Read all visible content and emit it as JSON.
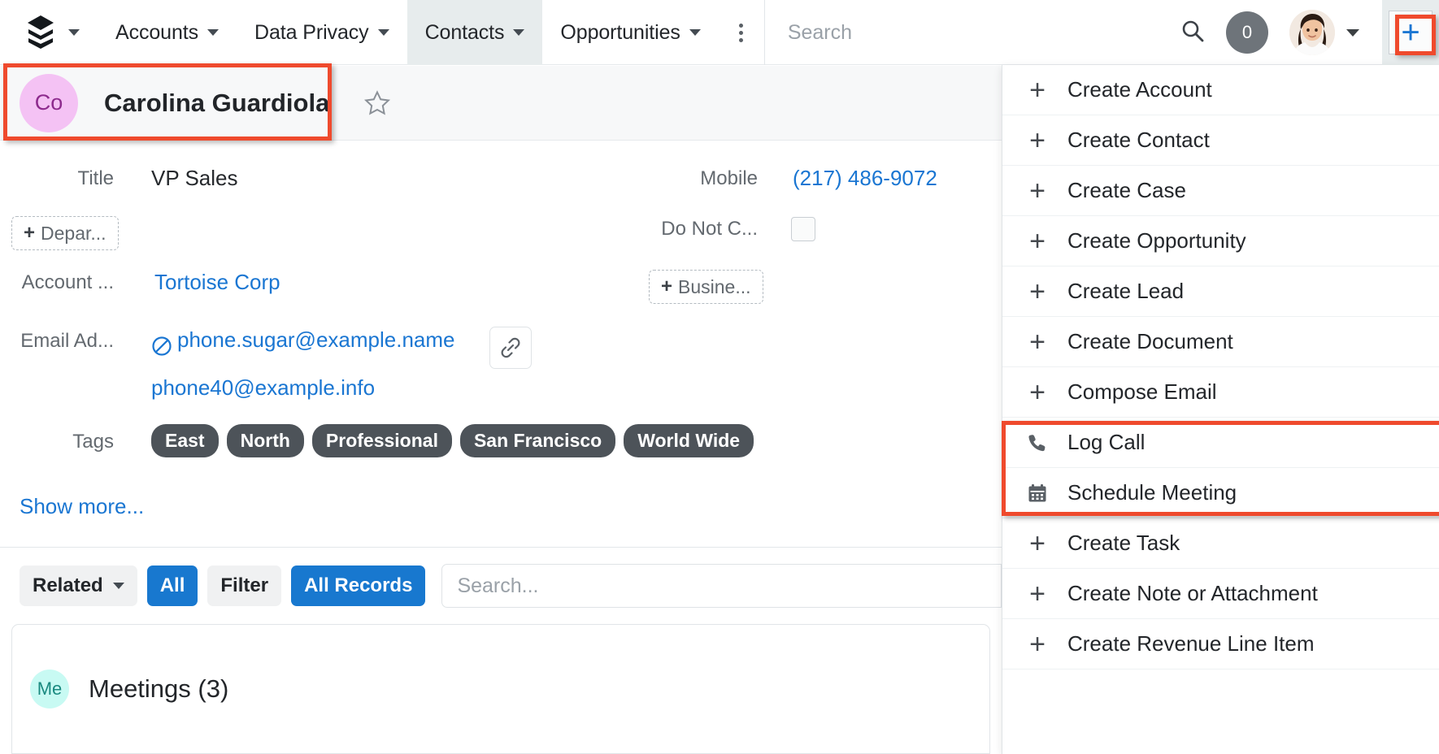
{
  "navbar": {
    "logo_icon": "layers-stack-icon",
    "logo_caret_icon": "chevron-down-icon",
    "modules": [
      {
        "label": "Accounts",
        "active": false
      },
      {
        "label": "Data Privacy",
        "active": false
      },
      {
        "label": "Contacts",
        "active": true
      },
      {
        "label": "Opportunities",
        "active": false
      }
    ],
    "overflow_icon": "kebab-menu-icon",
    "search": {
      "placeholder": "Search",
      "icon": "search-icon"
    },
    "notifications_count": "0",
    "avatar_icon": "user-avatar",
    "avatar_caret_icon": "chevron-down-icon",
    "create_button_label": "+",
    "create_button_icon": "plus-icon"
  },
  "record": {
    "avatar_initials": "Co",
    "name": "Carolina Guardiola",
    "favorite_icon": "star-outline-icon"
  },
  "detail": {
    "fields": {
      "title_label": "Title",
      "title_value": "VP Sales",
      "department_add": "Depar...",
      "account_label": "Account ...",
      "account_value": "Tortoise Corp",
      "email_label": "Email Ad...",
      "email_primary": "phone.sugar@example.name",
      "email_secondary": "phone40@example.info",
      "email_opt_out_icon": "no-entry-icon",
      "email_link_icon": "link-chain-icon",
      "mobile_label": "Mobile",
      "mobile_value": "(217) 486-9072",
      "do_not_call_label": "Do Not C...",
      "business_add": "Busine...",
      "tags_label": "Tags"
    },
    "tags": [
      "East",
      "North",
      "Professional",
      "San Francisco",
      "World Wide"
    ],
    "show_more": "Show more..."
  },
  "toolbar": {
    "related_label": "Related",
    "related_caret_icon": "chevron-down-icon",
    "all_label": "All",
    "filter_label": "Filter",
    "all_records_label": "All Records",
    "search_placeholder": "Search..."
  },
  "meetings": {
    "badge": "Me",
    "title": "Meetings (3)"
  },
  "dropdown": {
    "items": [
      {
        "label": "Create Account",
        "icon": "plus-icon",
        "highlighted": false
      },
      {
        "label": "Create Contact",
        "icon": "plus-icon",
        "highlighted": false
      },
      {
        "label": "Create Case",
        "icon": "plus-icon",
        "highlighted": false
      },
      {
        "label": "Create Opportunity",
        "icon": "plus-icon",
        "highlighted": false
      },
      {
        "label": "Create Lead",
        "icon": "plus-icon",
        "highlighted": false
      },
      {
        "label": "Create Document",
        "icon": "plus-icon",
        "highlighted": false
      },
      {
        "label": "Compose Email",
        "icon": "plus-icon",
        "highlighted": false
      },
      {
        "label": "Log Call",
        "icon": "phone-icon",
        "highlighted": true
      },
      {
        "label": "Schedule Meeting",
        "icon": "calendar-icon",
        "highlighted": true
      },
      {
        "label": "Create Task",
        "icon": "plus-icon",
        "highlighted": false
      },
      {
        "label": "Create Note or Attachment",
        "icon": "plus-icon",
        "highlighted": false
      },
      {
        "label": "Create Revenue Line Item",
        "icon": "plus-icon",
        "highlighted": false
      }
    ]
  },
  "colors": {
    "accent_blue": "#1a76d2",
    "annotation_red": "#ef4a2d",
    "tag_grey": "#4d5359",
    "record_avatar_pink": "#f4c2f4",
    "meetings_badge_mint": "#c8faf3"
  }
}
